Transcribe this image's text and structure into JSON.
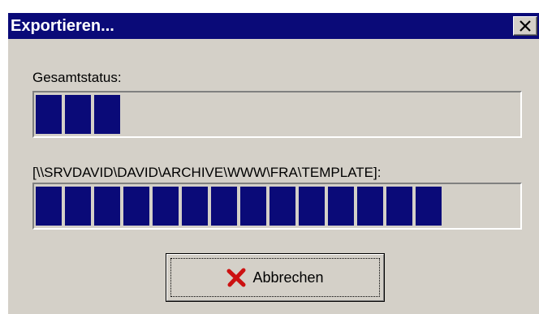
{
  "window": {
    "title": "Exportieren...",
    "close_icon": "close-icon"
  },
  "overall": {
    "label": "Gesamtstatus:",
    "progress_blocks": 3,
    "progress_fraction": 0.18
  },
  "file": {
    "label": "[\\\\SRVDAVID\\DAVID\\ARCHIVE\\WWW\\FRA\\TEMPLATE]:",
    "progress_blocks": 14,
    "progress_fraction": 0.84
  },
  "cancel_button": {
    "label": "Abbrechen",
    "icon": "cancel-x-icon"
  },
  "colors": {
    "titlebar": "#0a0a78",
    "progress_fill": "#0a0a78",
    "dialog_bg": "#d4d0c8",
    "cancel_icon": "#cc1111"
  }
}
